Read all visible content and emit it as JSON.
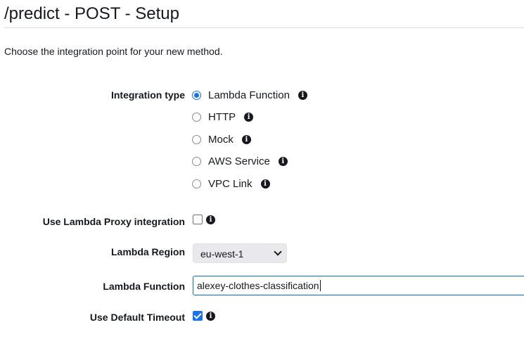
{
  "page": {
    "title": "/predict - POST - Setup",
    "description": "Choose the integration point for your new method."
  },
  "integration_type": {
    "label": "Integration type",
    "options": [
      {
        "label": "Lambda Function",
        "selected": true
      },
      {
        "label": "HTTP",
        "selected": false
      },
      {
        "label": "Mock",
        "selected": false
      },
      {
        "label": "AWS Service",
        "selected": false
      },
      {
        "label": "VPC Link",
        "selected": false
      }
    ]
  },
  "lambda_proxy": {
    "label": "Use Lambda Proxy integration",
    "checked": false
  },
  "lambda_region": {
    "label": "Lambda Region",
    "value": "eu-west-1"
  },
  "lambda_function": {
    "label": "Lambda Function",
    "value": "alexey-clothes-classification"
  },
  "default_timeout": {
    "label": "Use Default Timeout",
    "checked": true
  },
  "icons": {
    "info": "info-icon",
    "dropdown": "chevron-down-icon"
  },
  "colors": {
    "accent": "#1a73e8",
    "input_border": "#0073bb"
  }
}
